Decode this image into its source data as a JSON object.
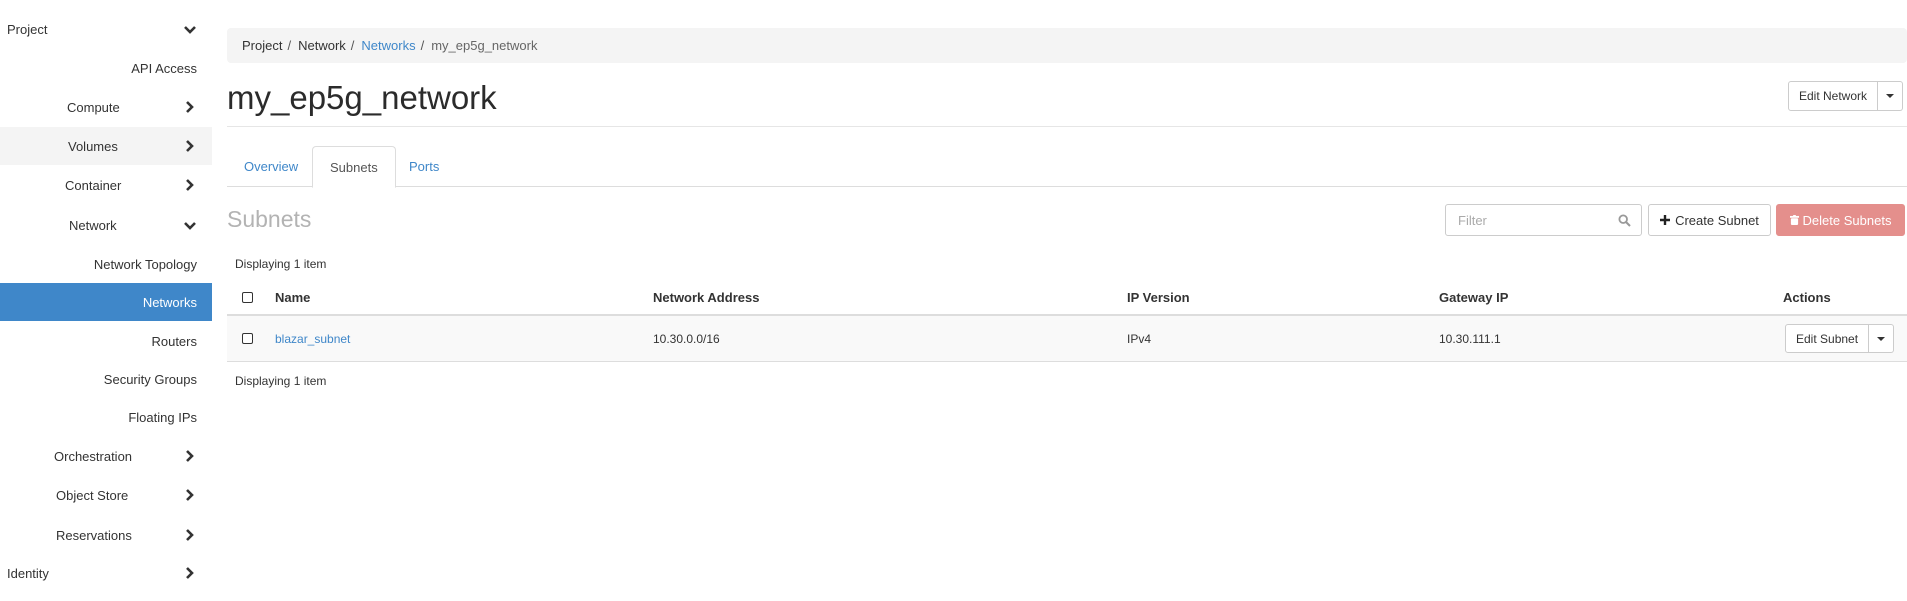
{
  "sidebar": {
    "items": [
      {
        "label": "Project",
        "icon": "chevron-down-icon"
      },
      {
        "label": "API Access",
        "icon": null
      },
      {
        "label": "Compute",
        "icon": "chevron-right-icon"
      },
      {
        "label": "Volumes",
        "icon": "chevron-right-icon"
      },
      {
        "label": "Container",
        "icon": "chevron-right-icon"
      },
      {
        "label": "Network",
        "icon": "chevron-down-icon"
      },
      {
        "label": "Network Topology",
        "icon": null
      },
      {
        "label": "Networks",
        "icon": null,
        "active": true
      },
      {
        "label": "Routers",
        "icon": null
      },
      {
        "label": "Security Groups",
        "icon": null
      },
      {
        "label": "Floating IPs",
        "icon": null
      },
      {
        "label": "Orchestration",
        "icon": "chevron-right-icon"
      },
      {
        "label": "Object Store",
        "icon": "chevron-right-icon"
      },
      {
        "label": "Reservations",
        "icon": "chevron-right-icon"
      },
      {
        "label": "Identity",
        "icon": "chevron-right-icon"
      }
    ]
  },
  "breadcrumb": [
    "Project",
    "Network",
    "Networks",
    "my_ep5g_network"
  ],
  "page": {
    "title": "my_ep5g_network",
    "edit_network_label": "Edit Network"
  },
  "tabs": [
    {
      "label": "Overview",
      "active": false
    },
    {
      "label": "Subnets",
      "active": true
    },
    {
      "label": "Ports",
      "active": false
    }
  ],
  "subnets": {
    "title": "Subnets",
    "filter_placeholder": "Filter",
    "filter_value": "",
    "create_label": "Create Subnet",
    "delete_label": "Delete Subnets",
    "count_top": "Displaying 1 item",
    "count_bottom": "Displaying 1 item",
    "columns": [
      "Name",
      "Network Address",
      "IP Version",
      "Gateway IP",
      "Actions"
    ],
    "rows": [
      {
        "name": "blazar_subnet",
        "network_address": "10.30.0.0/16",
        "ip_version": "IPv4",
        "gateway_ip": "10.30.111.1",
        "action_label": "Edit Subnet"
      }
    ]
  },
  "colors": {
    "accent": "#3f87c9",
    "danger_disabled": "#e48f8c",
    "breadcrumb_bg": "#f4f4f4"
  }
}
